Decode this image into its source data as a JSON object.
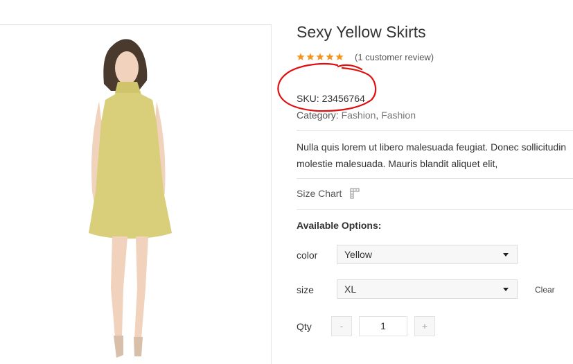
{
  "product": {
    "title": "Sexy Yellow Skirts",
    "rating_stars": 5,
    "review_text": "(1 customer review)",
    "sku_label": "SKU:",
    "sku_value": "23456764",
    "category_label": "Category:",
    "categories": [
      "Fashion",
      "Fashion"
    ],
    "description": "Nulla quis lorem ut libero malesuada feugiat. Donec sollicitudin molestie malesuada. Mauris blandit aliquet elit,",
    "size_chart_label": "Size Chart"
  },
  "options": {
    "title": "Available Options:",
    "color": {
      "label": "color",
      "value": "Yellow"
    },
    "size": {
      "label": "size",
      "value": "XL"
    },
    "clear_label": "Clear"
  },
  "quantity": {
    "label": "Qty",
    "minus": "-",
    "value": "1",
    "plus": "+"
  },
  "colors": {
    "star": "#f7941d",
    "dress": "#d9cf7a",
    "annotation": "#e01010"
  },
  "icons": {
    "star": "star-icon",
    "size_chart": "ruler-icon",
    "caret": "chevron-down-icon"
  }
}
